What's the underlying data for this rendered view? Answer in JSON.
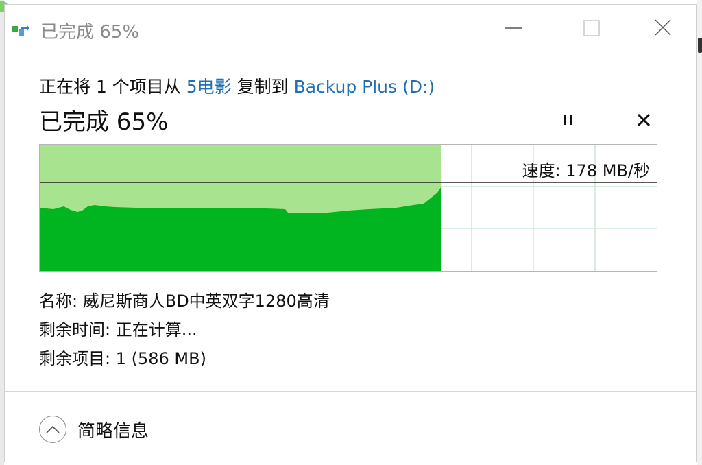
{
  "window": {
    "title": "已完成 65%",
    "controls": {
      "minimize": "minimize-icon",
      "maximize": "maximize-icon",
      "close": "close-icon"
    }
  },
  "summary": {
    "prefix": "正在将 1 个项目从 ",
    "source": "5电影",
    "middle": " 复制到 ",
    "destination": "Backup Plus (D:)"
  },
  "progress": {
    "title": "已完成 65%",
    "percent": 65,
    "speed_label": "速度: 178 MB/秒",
    "pause_icon": "pause-icon",
    "cancel_icon": "cancel-icon"
  },
  "details": {
    "name_label": "名称:",
    "name_value": "威尼斯商人BD中英双字1280高清",
    "time_label": "剩余时间:",
    "time_value": "正在计算...",
    "items_label": "剩余项目:",
    "items_value": "1 (586 MB)"
  },
  "footer": {
    "toggle_label": "简略信息",
    "toggle_icon": "chevron-up-icon"
  },
  "colors": {
    "fill_done": "#a8e38f",
    "fill_speed": "#00b51f",
    "grid": "#cfe6d5",
    "link": "#1f6fb2"
  }
}
